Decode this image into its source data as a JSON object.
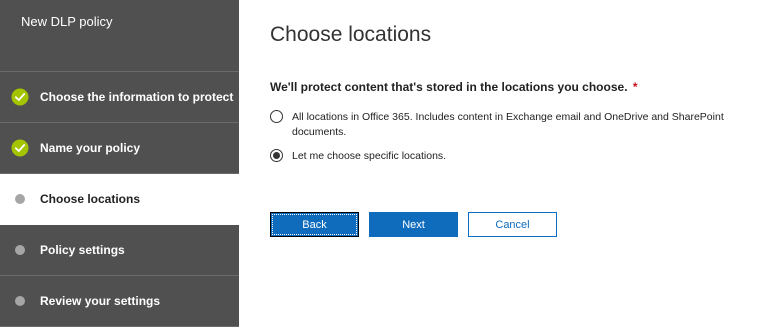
{
  "sidebar": {
    "title": "New DLP policy",
    "steps": [
      {
        "label": "Choose the information to protect",
        "state": "complete"
      },
      {
        "label": "Name your policy",
        "state": "complete"
      },
      {
        "label": "Choose locations",
        "state": "current"
      },
      {
        "label": "Policy settings",
        "state": "pending"
      },
      {
        "label": "Review your settings",
        "state": "pending"
      }
    ]
  },
  "main": {
    "title": "Choose locations",
    "question": "We'll protect content that's stored in the locations you choose.",
    "required_marker": "*",
    "options": [
      {
        "label": "All locations in Office 365. Includes content in Exchange email and OneDrive and SharePoint documents.",
        "selected": false
      },
      {
        "label": "Let me choose specific locations.",
        "selected": true
      }
    ]
  },
  "footer": {
    "back_label": "Back",
    "next_label": "Next",
    "cancel_label": "Cancel"
  },
  "colors": {
    "sidebar_bg": "#505050",
    "check_green": "#a4c400",
    "primary_blue": "#0f6cbd",
    "required_red": "#c50f1f"
  }
}
